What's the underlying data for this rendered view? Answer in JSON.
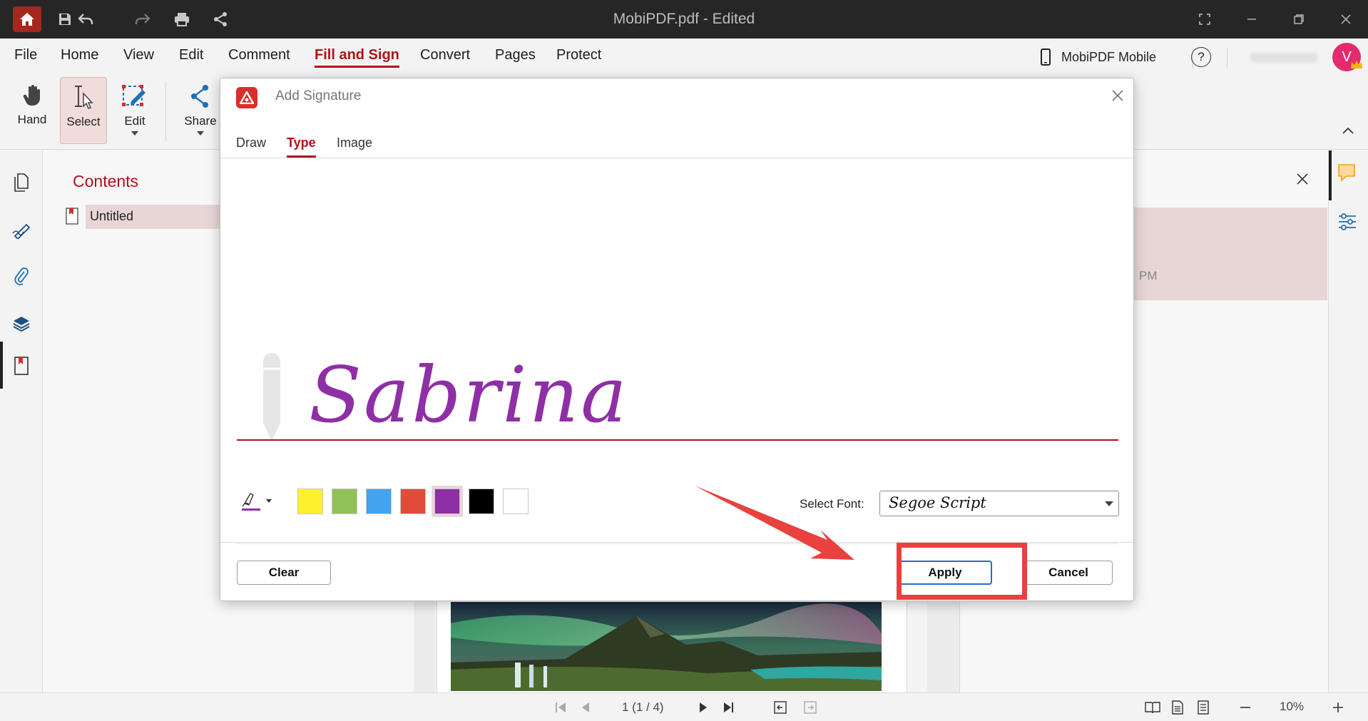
{
  "window": {
    "title": "MobiPDF.pdf - Edited"
  },
  "menu": {
    "items": [
      "File",
      "Home",
      "View",
      "Edit",
      "Comment",
      "Fill and Sign",
      "Convert",
      "Pages",
      "Protect"
    ],
    "active": "Fill and Sign",
    "mobile_label": "MobiPDF Mobile",
    "avatar_initial": "V"
  },
  "ribbon": {
    "hand": "Hand",
    "select": "Select",
    "edit": "Edit",
    "share": "Share"
  },
  "contents_panel": {
    "title": "Contents",
    "items": [
      "Untitled"
    ]
  },
  "right_panel": {
    "time_suffix": "PM"
  },
  "dialog": {
    "title": "Add Signature",
    "tabs": [
      "Draw",
      "Type",
      "Image"
    ],
    "active_tab": "Type",
    "signature_text": "Sabrina",
    "signature_color": "#8e2fa6",
    "colors": [
      "#fff02d",
      "#92c15b",
      "#42a4f0",
      "#e04b3a",
      "#8e2fa6",
      "#000000",
      "#ffffff"
    ],
    "selected_color_index": 4,
    "select_font_label": "Select Font:",
    "font_value": "Segoe Script",
    "clear_label": "Clear",
    "apply_label": "Apply",
    "cancel_label": "Cancel"
  },
  "status": {
    "page_indicator": "1 (1 / 4)",
    "zoom": "10%"
  },
  "colors": {
    "accent": "#b1121b",
    "highlight": "#e8413e"
  }
}
